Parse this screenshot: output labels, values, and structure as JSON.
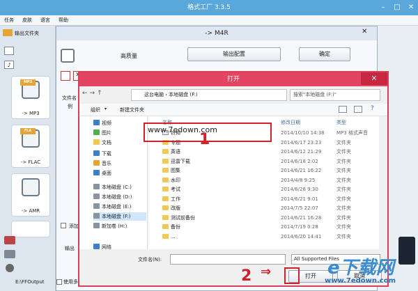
{
  "app": {
    "title": "格式工厂 3.3.5",
    "menu": [
      "任务",
      "皮肤",
      "语言",
      "帮助"
    ],
    "output_folder": "输出文件夹",
    "output_path": "E:\\FFOutput",
    "use_multi": "使用多线"
  },
  "formats": [
    {
      "tag": "MP3",
      "label": "-> MP3"
    },
    {
      "tag": "FLA",
      "label": "-> FLAC"
    },
    {
      "tag": "",
      "label": "-> AMR"
    },
    {
      "tag": "",
      "label": ""
    }
  ],
  "m4r": {
    "title": "-> M4R",
    "quality": "高质量",
    "output_settings": "输出配置",
    "ok": "确定",
    "file_name_col": "文件名",
    "list_item": "例",
    "add_label": "添加",
    "output_label": "输出"
  },
  "dialog": {
    "title": "打开",
    "breadcrumb": [
      "这台电脑",
      "本地磁盘 (F:)"
    ],
    "search_placeholder": "搜索\"本地磁盘 (F:)\"",
    "organize": "组织",
    "new_folder": "新建文件夹",
    "nav": [
      "视频",
      "图片",
      "文档",
      "下载",
      "音乐",
      "桌面",
      "本地磁盘 (C:)",
      "本地磁盘 (D:)",
      "本地磁盘 (E:)",
      "本地磁盘 (F:)",
      "新加卷 (H:)",
      "网络"
    ],
    "columns": {
      "name": "名称",
      "date": "修改日期",
      "type": "类型"
    },
    "files": [
      {
        "name": "铃知",
        "date": "2014/10/10 14:38",
        "type": "MP3 格式声音"
      },
      {
        "name": "专题",
        "date": "2014/6/17 23:23",
        "type": "文件夹"
      },
      {
        "name": "英语",
        "date": "2014/6/12 21:29",
        "type": "文件夹"
      },
      {
        "name": "迅雷下载",
        "date": "2014/6/18 2:02",
        "type": "文件夹"
      },
      {
        "name": "图集",
        "date": "2014/6/21 16:22",
        "type": "文件夹"
      },
      {
        "name": "水印",
        "date": "2014/4/8 9:25",
        "type": "文件夹"
      },
      {
        "name": "考试",
        "date": "2014/6/28 9:30",
        "type": "文件夹"
      },
      {
        "name": "工作",
        "date": "2014/6/21 9:01",
        "type": "文件夹"
      },
      {
        "name": "改版",
        "date": "2014/7/5 22:07",
        "type": "文件夹"
      },
      {
        "name": "测试前备份",
        "date": "2014/6/21 16:28",
        "type": "文件夹"
      },
      {
        "name": "备份",
        "date": "2014/7/19 0:28",
        "type": "文件夹"
      },
      {
        "name": "...",
        "date": "2014/6/20 14:41",
        "type": "文件夹"
      }
    ],
    "filename_label": "文件名(N):",
    "filetype_value": "All Supported Files",
    "open_button": "打开",
    "cancel_button": "取消"
  },
  "overlay": {
    "watermark_top": "www.7edown.com",
    "number_1": "1",
    "number_2": "2",
    "brand_cn": "e下载网",
    "brand_url": "www.7edown.com"
  },
  "colors": {
    "title_blue": "#5aa7dc",
    "dialog_red": "#e44463",
    "highlight_red": "#d0202a"
  }
}
